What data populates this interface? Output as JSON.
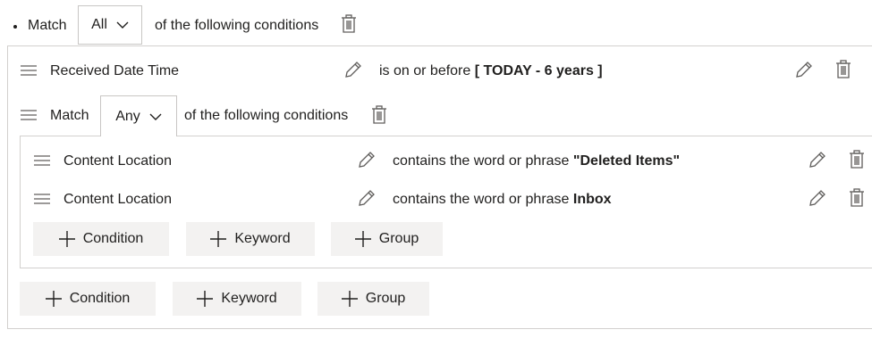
{
  "root": {
    "bullet": "•",
    "match_label": "Match",
    "match_value": "All",
    "suffix": "of the following conditions"
  },
  "row1": {
    "field": "Received Date Time",
    "condition_prefix": "is on or before",
    "condition_value": "[ TODAY - 6 years ]"
  },
  "group": {
    "match_label": "Match",
    "match_value": "Any",
    "suffix": "of the following conditions",
    "rows": [
      {
        "field": "Content Location",
        "condition_prefix": "contains the word or phrase",
        "condition_value": "\"Deleted Items\""
      },
      {
        "field": "Content Location",
        "condition_prefix": "contains the word or phrase",
        "condition_value": "Inbox"
      }
    ],
    "buttons": {
      "condition": "Condition",
      "keyword": "Keyword",
      "group": "Group"
    }
  },
  "outer_buttons": {
    "condition": "Condition",
    "keyword": "Keyword",
    "group": "Group"
  },
  "icons": {
    "drag": "drag-handle-icon",
    "edit": "pencil-icon",
    "delete": "trash-icon",
    "add": "plus-icon",
    "dropdown": "chevron-down-icon"
  }
}
